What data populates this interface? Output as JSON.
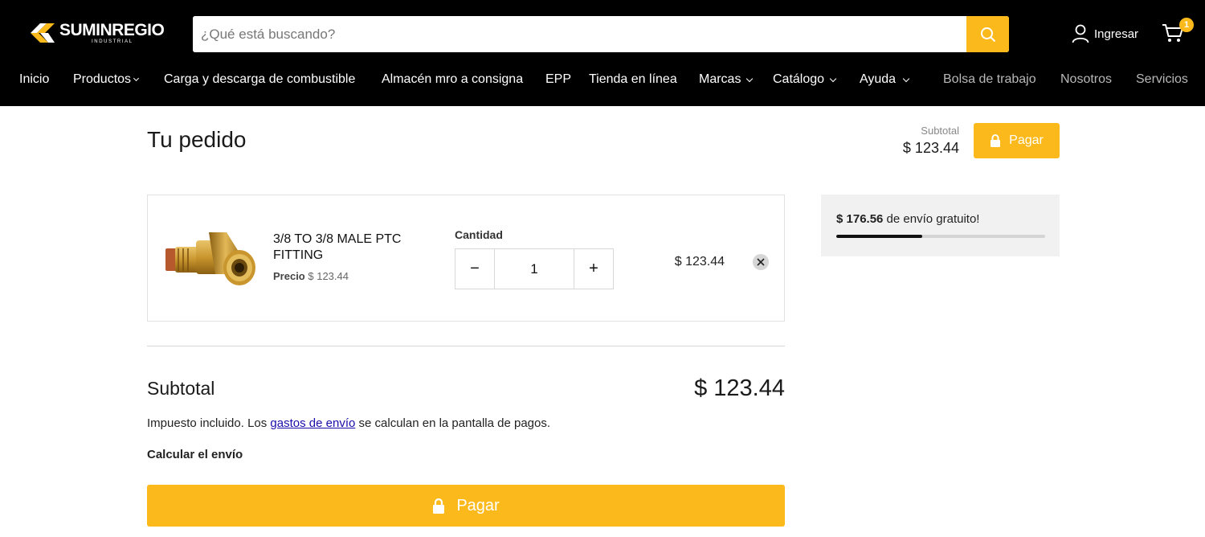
{
  "brand": {
    "name": "SUMINREGIO",
    "tagline": "INDUSTRIAL",
    "accent_color": "#fbb91b",
    "header_bg": "#000000"
  },
  "search": {
    "placeholder": "¿Qué está buscando?",
    "value": "",
    "button_icon": "search-icon"
  },
  "account": {
    "label": "Ingresar",
    "icon": "user-icon"
  },
  "cart": {
    "icon": "cart-icon",
    "count": "1"
  },
  "nav": [
    {
      "label": "Inicio",
      "dropdown": false
    },
    {
      "label": "Productos",
      "dropdown": true
    },
    {
      "label": "Carga y descarga de combustible",
      "dropdown": false
    },
    {
      "label": "Almacén mro a consigna",
      "dropdown": false
    },
    {
      "label": "EPP",
      "dropdown": false
    },
    {
      "label": "Tienda en línea",
      "dropdown": false
    },
    {
      "label": "Marcas",
      "dropdown": true
    },
    {
      "label": "Catálogo",
      "dropdown": true
    },
    {
      "label": "Ayuda",
      "dropdown": true
    },
    {
      "label": "Bolsa de trabajo",
      "dropdown": false
    },
    {
      "label": "Nosotros",
      "dropdown": false
    },
    {
      "label": "Servicios",
      "dropdown": false
    }
  ],
  "order": {
    "title": "Tu pedido",
    "subtotal_label": "Subtotal",
    "subtotal_value": "$ 123.44",
    "pay_label": "Pagar"
  },
  "item": {
    "title": "3/8 TO 3/8 MALE PTC FITTING",
    "price_label": "Precio",
    "price_value": "$ 123.44",
    "quantity_label": "Cantidad",
    "quantity": "1",
    "decrement": "−",
    "increment": "+",
    "line_total": "$ 123.44"
  },
  "summary": {
    "subtotal_label": "Subtotal",
    "subtotal_value": "$ 123.44",
    "tax_note_before": "Impuesto incluido. Los ",
    "tax_note_link": "gastos de envío",
    "tax_note_after": " se calculan en la pantalla de pagos.",
    "calc_shipping": "Calcular el envío",
    "pay_label": "Pagar"
  },
  "free_shipping": {
    "amount": "$ 176.56",
    "text": " de envío gratuito!",
    "progress": 0.41
  }
}
